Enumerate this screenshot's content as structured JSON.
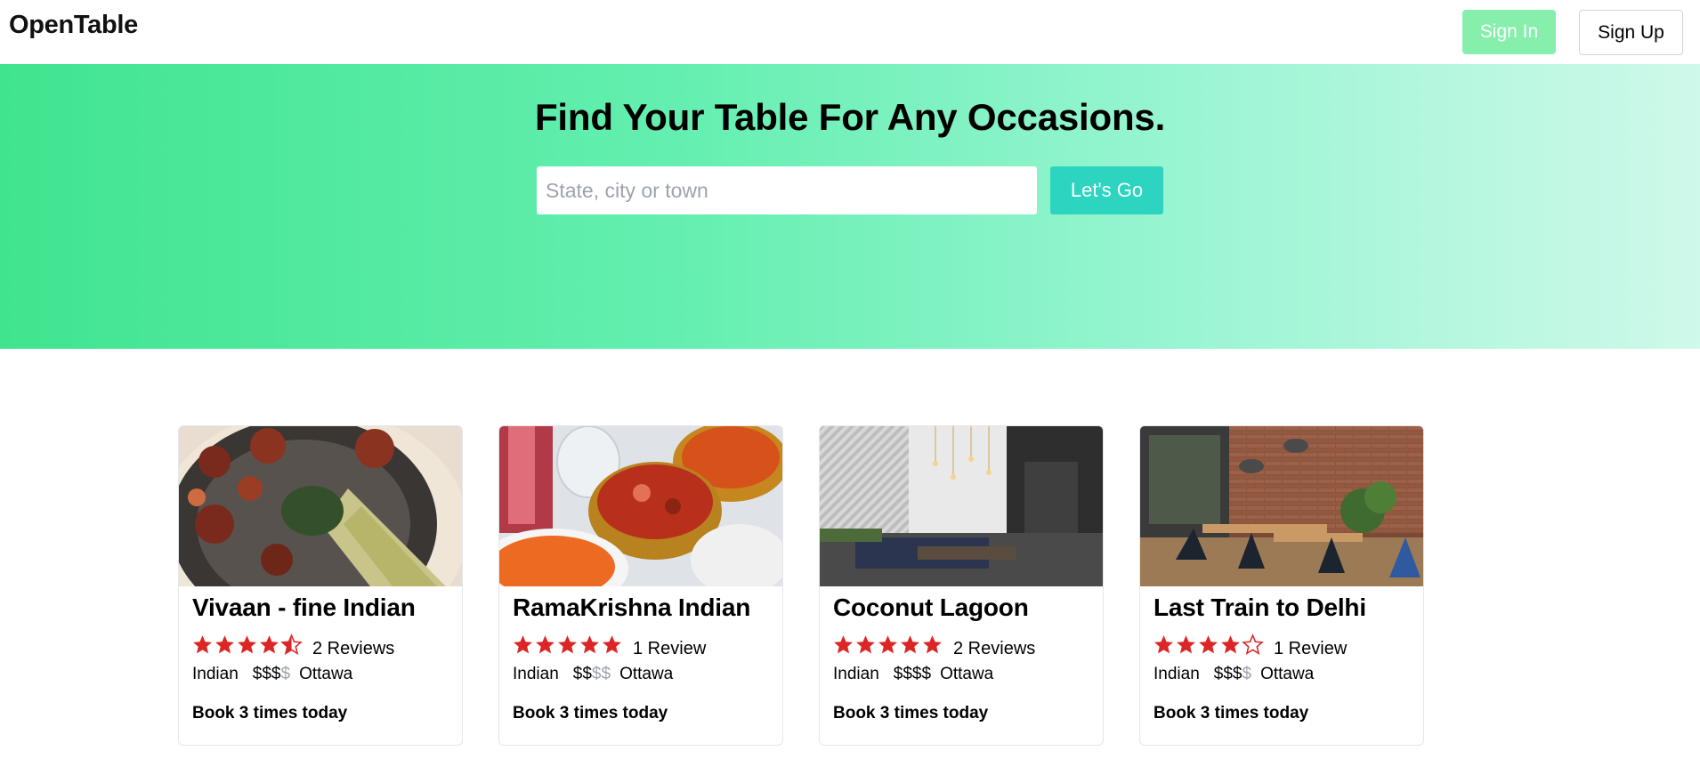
{
  "app": {
    "logo": "OpenTable"
  },
  "nav": {
    "sign_in": "Sign In",
    "sign_up": "Sign Up"
  },
  "hero": {
    "title": "Find Your Table For Any Occasions.",
    "search_placeholder": "State, city or town",
    "search_value": "",
    "button": "Let's Go"
  },
  "colors": {
    "star": "#dc2626",
    "sign_in_bg": "#86efac",
    "go_bg": "#2dd4bf",
    "price_dim": "#9ca3af"
  },
  "restaurants": [
    {
      "name": "Vivaan - fine Indian",
      "rating": 4.5,
      "reviews": "2 Reviews",
      "cuisine": "Indian",
      "price_active": "$$$",
      "price_dim": "$",
      "location": "Ottawa",
      "booking": "Book 3 times today",
      "image_icon": "food-photo"
    },
    {
      "name": "RamaKrishna Indian",
      "rating": 5,
      "reviews": "1 Review",
      "cuisine": "Indian",
      "price_active": "$$",
      "price_dim": "$$",
      "location": "Ottawa",
      "booking": "Book 3 times today",
      "image_icon": "food-photo"
    },
    {
      "name": "Coconut Lagoon",
      "rating": 5,
      "reviews": "2 Reviews",
      "cuisine": "Indian",
      "price_active": "$$$$",
      "price_dim": "",
      "location": "Ottawa",
      "booking": "Book 3 times today",
      "image_icon": "interior-photo"
    },
    {
      "name": "Last Train to Delhi",
      "rating": 4,
      "reviews": "1 Review",
      "cuisine": "Indian",
      "price_active": "$$$",
      "price_dim": "$",
      "location": "Ottawa",
      "booking": "Book 3 times today",
      "image_icon": "interior-photo"
    }
  ]
}
